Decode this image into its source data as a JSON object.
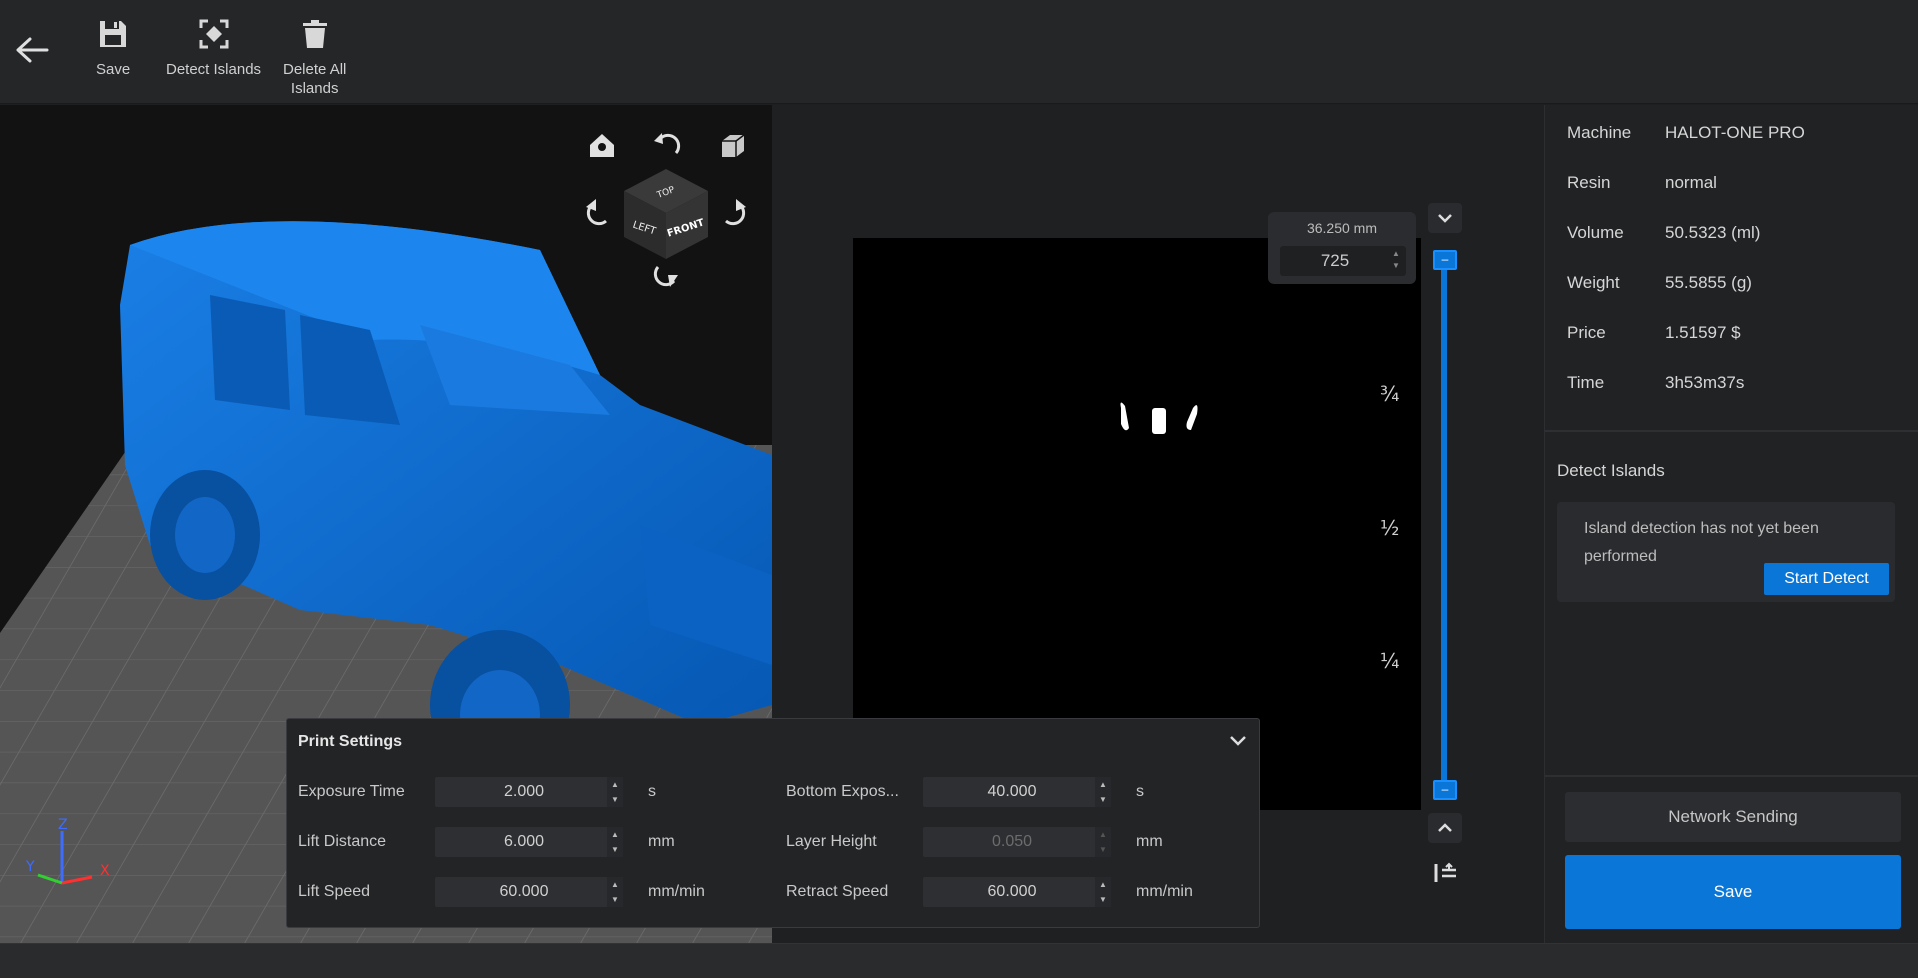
{
  "toolbar": {
    "save_label": "Save",
    "detect_label": "Detect Islands",
    "delete_label_line1": "Delete All",
    "delete_label_line2": "Islands"
  },
  "viewport": {
    "model_color": "#0a6fd6",
    "cube_top": "TOP",
    "cube_left": "LEFT",
    "cube_front": "FRONT",
    "axis_z": "Z",
    "axis_y": "Y",
    "axis_x": "X"
  },
  "slice": {
    "height_mm": "36.250 mm",
    "layer": "725",
    "frac_34": "¾",
    "frac_12": "½",
    "frac_14": "¼",
    "handle_glyph": "–"
  },
  "print_settings": {
    "title": "Print Settings",
    "fields": [
      {
        "label": "Exposure Time",
        "value": "2.000",
        "unit": "s"
      },
      {
        "label": "Lift Distance",
        "value": "6.000",
        "unit": "mm"
      },
      {
        "label": "Lift Speed",
        "value": "60.000",
        "unit": "mm/min"
      },
      {
        "label": "Bottom Expos...",
        "value": "40.000",
        "unit": "s"
      },
      {
        "label": "Layer Height",
        "value": "0.050",
        "unit": "mm"
      },
      {
        "label": "Retract Speed",
        "value": "60.000",
        "unit": "mm/min"
      }
    ]
  },
  "info": {
    "rows": [
      {
        "key": "Machine",
        "value": "HALOT-ONE PRO"
      },
      {
        "key": "Resin",
        "value": "normal"
      },
      {
        "key": "Volume",
        "value": "50.5323 (ml)"
      },
      {
        "key": "Weight",
        "value": "55.5855 (g)"
      },
      {
        "key": "Price",
        "value": "1.51597 $"
      },
      {
        "key": "Time",
        "value": "3h53m37s"
      }
    ],
    "detect_title": "Detect Islands",
    "detect_message": "Island detection has not yet been performed",
    "start_detect": "Start Detect",
    "network_sending": "Network Sending",
    "save": "Save"
  },
  "colors": {
    "accent": "#0a77d8",
    "background": "#1e1f21",
    "panel": "#232426"
  }
}
